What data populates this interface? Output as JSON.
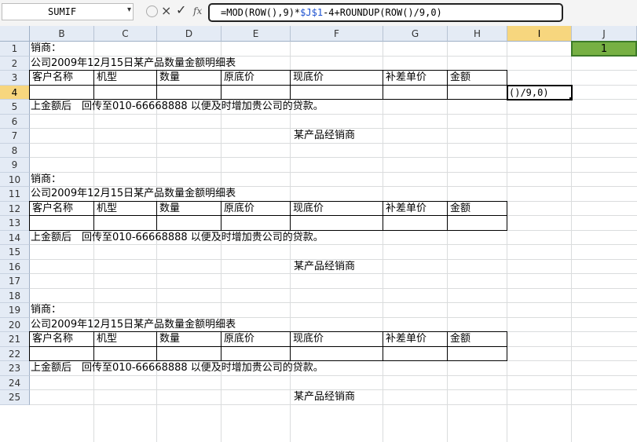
{
  "formula_bar": {
    "name_box": "SUMIF",
    "dropdown_icon": "chevron-down-icon",
    "cancel_glyph": "×",
    "enter_glyph": "✓",
    "fx_glyph": "fx",
    "formula_parts": [
      "=MOD(ROW(),9)*",
      "$J$1",
      "-4+ROUNDUP(ROW()/9,0)"
    ]
  },
  "columns": [
    "B",
    "C",
    "D",
    "E",
    "F",
    "G",
    "H",
    "I",
    "J"
  ],
  "selected_column": "I",
  "row_numbers": [
    "1",
    "2",
    "3",
    "4",
    "5",
    "6",
    "7",
    "8",
    "9",
    "10",
    "11",
    "12",
    "13",
    "14",
    "15",
    "16",
    "17",
    "18",
    "19",
    "20",
    "21",
    "22",
    "23",
    "24",
    "25"
  ],
  "selected_row": "4",
  "cells": {
    "j1_value": "1",
    "i4_editing": "()/9,0)"
  },
  "blocks": [
    {
      "dealer": "销商：",
      "title": "公司2009年12月15日某产品数量金额明细表",
      "headers": [
        "客户名称",
        "机型",
        "数量",
        "原底价",
        "现底价",
        "补差单价",
        "金额"
      ],
      "note": "上金额后　回传至010-66668888 以便及时增加贵公司的贷款。",
      "footer": "某产品经销商"
    },
    {
      "dealer": "销商：",
      "title": "公司2009年12月15日某产品数量金额明细表",
      "headers": [
        "客户名称",
        "机型",
        "数量",
        "原底价",
        "现底价",
        "补差单价",
        "金额"
      ],
      "note": "上金额后　回传至010-66668888 以便及时增加贵公司的贷款。",
      "footer": "某产品经销商"
    },
    {
      "dealer": "销商：",
      "title": "公司2009年12月15日某产品数量金额明细表",
      "headers": [
        "客户名称",
        "机型",
        "数量",
        "原底价",
        "现底价",
        "补差单价",
        "金额"
      ],
      "note": "上金额后　回传至010-66668888 以便及时增加贵公司的贷款。",
      "footer": "某产品经销商"
    }
  ]
}
